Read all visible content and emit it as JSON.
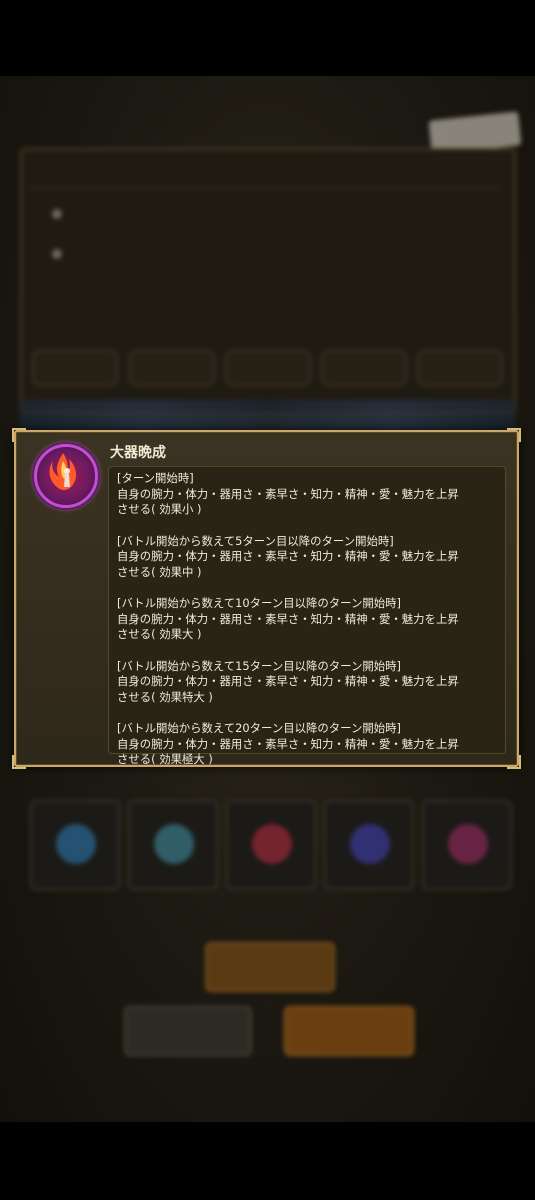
{
  "skill_popup": {
    "icon": "flame-figure-icon",
    "name": "大器晩成",
    "entries": [
      {
        "condition": "[ターン開始時]",
        "line1": "自身の腕力・体力・器用さ・素早さ・知力・精神・愛・魅力を上昇",
        "line2": "させる( 効果小 )"
      },
      {
        "condition": "[バトル開始から数えて5ターン目以降のターン開始時]",
        "line1": "自身の腕力・体力・器用さ・素早さ・知力・精神・愛・魅力を上昇",
        "line2": "させる( 効果中 )"
      },
      {
        "condition": "[バトル開始から数えて10ターン目以降のターン開始時]",
        "line1": "自身の腕力・体力・器用さ・素早さ・知力・精神・愛・魅力を上昇",
        "line2": "させる( 効果大 )"
      },
      {
        "condition": "[バトル開始から数えて15ターン目以降のターン開始時]",
        "line1": "自身の腕力・体力・器用さ・素早さ・知力・精神・愛・魅力を上昇",
        "line2": "させる( 効果特大 )"
      },
      {
        "condition": "[バトル開始から数えて20ターン目以降のターン開始時]",
        "line1": "自身の腕力・体力・器用さ・素早さ・知力・精神・愛・魅力を上昇",
        "line2": "させる( 効果極大 )"
      }
    ]
  },
  "colors": {
    "popup_border": "#c9a869",
    "popup_bg": "#3b3322",
    "text": "#f0ead8",
    "icon_ring": "#c24fcf"
  }
}
